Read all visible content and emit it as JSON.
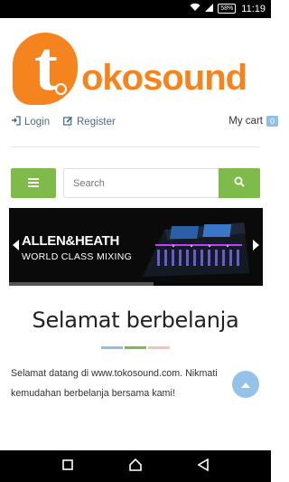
{
  "status_bar": {
    "battery": "58%",
    "time": "11:19"
  },
  "logo": {
    "text_part1": "oko",
    "text_part2": "sound"
  },
  "topnav": {
    "login": "Login",
    "register": "Register",
    "cart_label": "My cart",
    "cart_count": "0"
  },
  "search": {
    "placeholder": "Search"
  },
  "banner": {
    "brand": "ALLEN&HEATH",
    "slogan": "WORLD CLASS MIXING"
  },
  "main": {
    "title": "Selamat berbelanja",
    "intro": "Selamat datang di www.tokosound.com. Nikmati kemudahan berbelanja bersama kami!"
  },
  "colors": {
    "accent_green": "#7fbb4a",
    "brand_orange": "#f5841f",
    "light_blue": "#8fbfe8",
    "bar_blue": "#8fbfe8",
    "bar_green": "#7fbb4a",
    "bar_pink": "#f0c2c2"
  }
}
